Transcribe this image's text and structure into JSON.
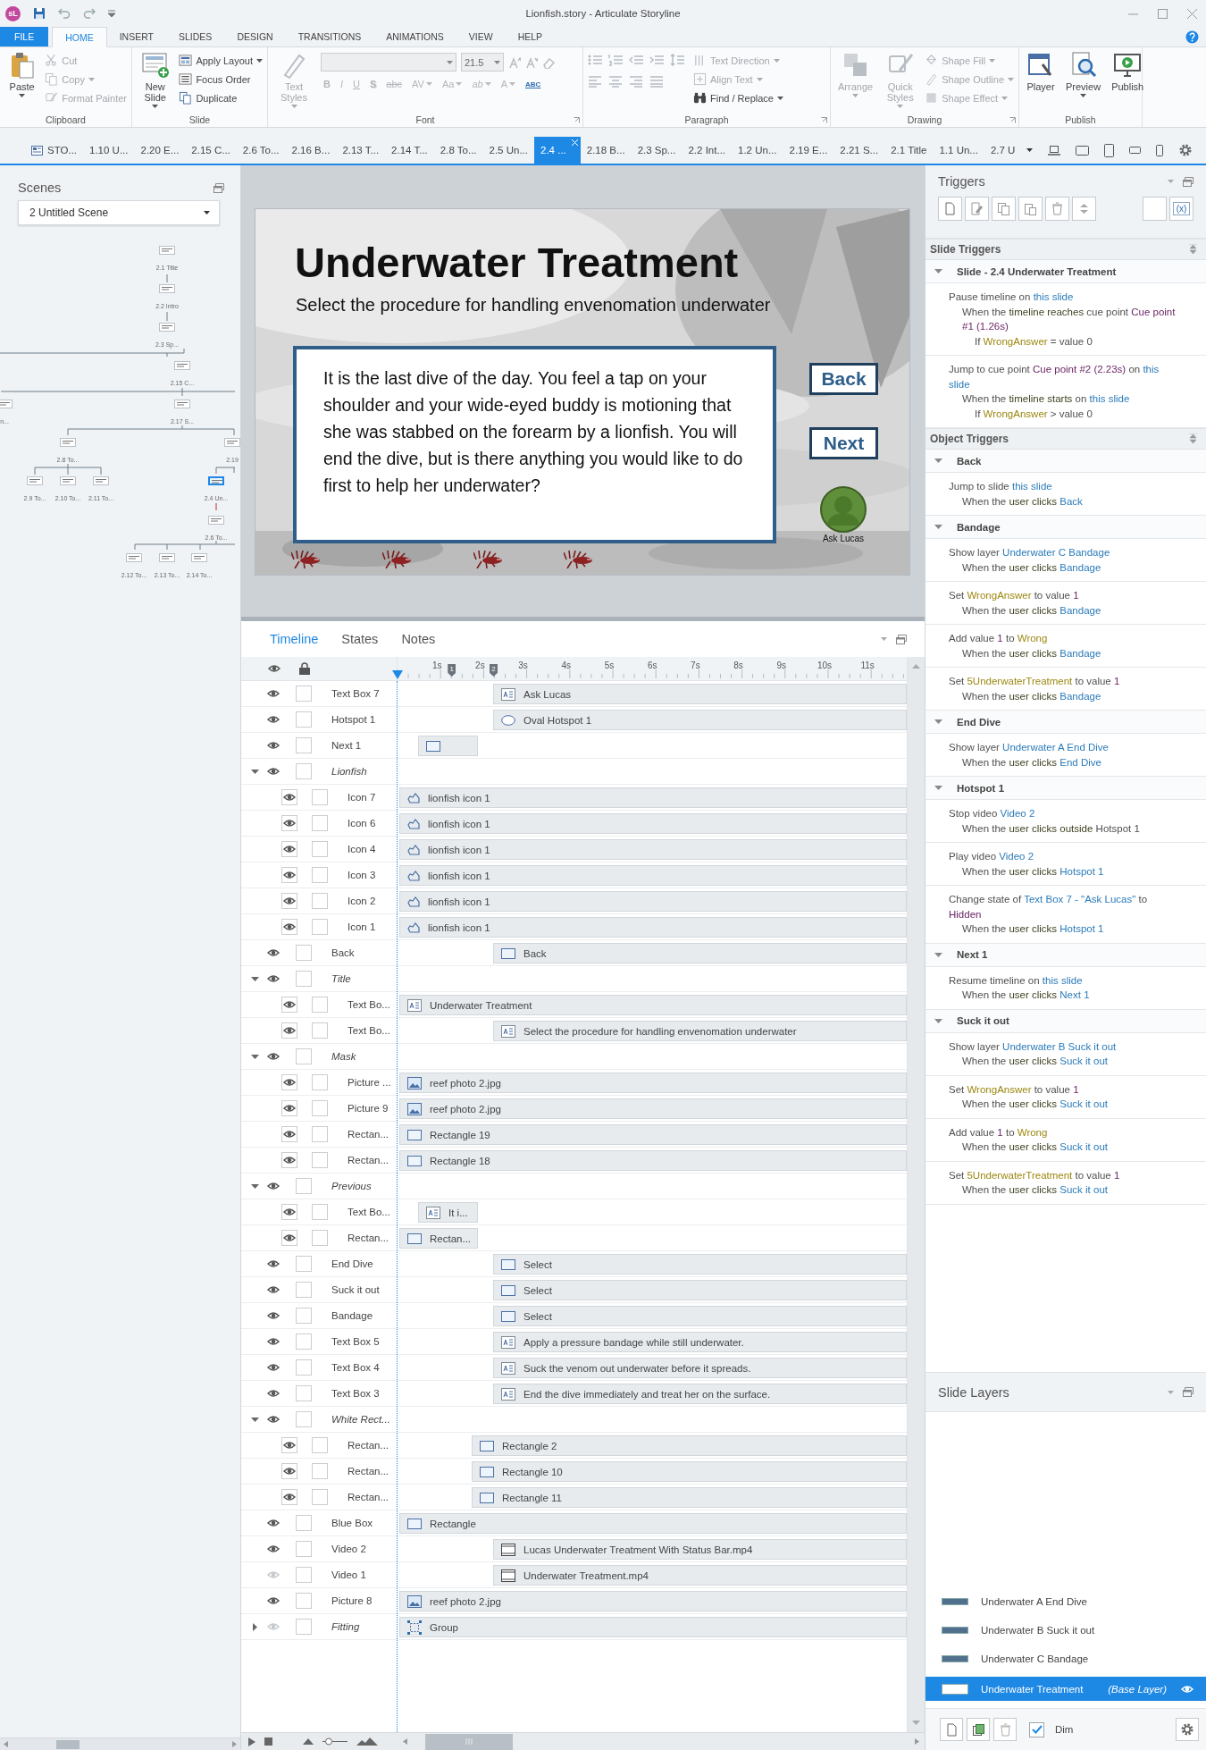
{
  "app": {
    "logo": "sL",
    "title": "Lionfish.story - Articulate Storyline"
  },
  "ribbon": {
    "tabs": [
      {
        "label": "FILE",
        "kind": "file",
        "selected": false
      },
      {
        "label": "HOME",
        "kind": "tab",
        "selected": true
      },
      {
        "label": "INSERT",
        "kind": "tab",
        "selected": false
      },
      {
        "label": "SLIDES",
        "kind": "tab",
        "selected": false
      },
      {
        "label": "DESIGN",
        "kind": "tab",
        "selected": false
      },
      {
        "label": "TRANSITIONS",
        "kind": "tab",
        "selected": false
      },
      {
        "label": "ANIMATIONS",
        "kind": "tab",
        "selected": false
      },
      {
        "label": "VIEW",
        "kind": "tab",
        "selected": false
      },
      {
        "label": "HELP",
        "kind": "tab",
        "selected": false
      }
    ],
    "groups": [
      {
        "label": "Clipboard",
        "kind": "clipboard",
        "large": [
          {
            "label": "Paste",
            "disabled": false,
            "dropdown": true
          }
        ],
        "small": [
          {
            "label": "Cut",
            "disabled": true,
            "dropdown": false
          },
          {
            "label": "Copy",
            "disabled": true,
            "dropdown": true
          },
          {
            "label": "Format Painter",
            "disabled": true,
            "dropdown": false
          }
        ]
      },
      {
        "label": "Slide",
        "kind": "slide",
        "large": [
          {
            "label": "New Slide",
            "disabled": false,
            "dropdown": true
          }
        ],
        "small": [
          {
            "label": "Apply Layout",
            "disabled": false,
            "dropdown": true
          },
          {
            "label": "Focus Order",
            "disabled": false,
            "dropdown": false
          },
          {
            "label": "Duplicate",
            "disabled": false,
            "dropdown": false
          }
        ]
      },
      {
        "label": "Font",
        "kind": "font",
        "large": [
          {
            "label": "Text Styles",
            "disabled": true,
            "dropdown": true
          }
        ],
        "font_size": "21.5",
        "glyphs": [
          {
            "text": "B",
            "disabled": true
          },
          {
            "text": "I",
            "disabled": true
          },
          {
            "text": "U",
            "disabled": true
          },
          {
            "text": "S",
            "disabled": true
          },
          {
            "text": "abc",
            "disabled": true
          },
          {
            "text": "AV",
            "disabled": true
          },
          {
            "text": "Aa",
            "disabled": true
          },
          {
            "text": "ab",
            "disabled": true
          },
          {
            "text": "A",
            "disabled": true
          },
          {
            "text": "ABC",
            "disabled": false
          }
        ]
      },
      {
        "label": "Paragraph",
        "kind": "paragraph",
        "small": [
          {
            "label": "Text Direction",
            "disabled": true,
            "dropdown": true
          },
          {
            "label": "Align Text",
            "disabled": true,
            "dropdown": true
          },
          {
            "label": "Find / Replace",
            "disabled": false,
            "dropdown": true
          }
        ]
      },
      {
        "label": "Drawing",
        "kind": "drawing",
        "large": [
          {
            "label": "Arrange",
            "disabled": true,
            "dropdown": true
          },
          {
            "label": "Quick Styles",
            "disabled": true,
            "dropdown": true
          }
        ],
        "small": [
          {
            "label": "Shape Fill",
            "disabled": true,
            "dropdown": true
          },
          {
            "label": "Shape Outline",
            "disabled": true,
            "dropdown": true
          },
          {
            "label": "Shape Effect",
            "disabled": true,
            "dropdown": true
          }
        ]
      },
      {
        "label": "Publish",
        "kind": "publish",
        "large": [
          {
            "label": "Player",
            "disabled": false,
            "dropdown": false
          },
          {
            "label": "Preview",
            "disabled": false,
            "dropdown": true
          },
          {
            "label": "Publish",
            "disabled": false,
            "dropdown": false
          }
        ]
      }
    ]
  },
  "slide_tabs": {
    "items": [
      {
        "label": "STO...",
        "kind": "story",
        "selected": false
      },
      {
        "label": "1.10 U...",
        "kind": "slide",
        "selected": false
      },
      {
        "label": "2.20 E...",
        "kind": "slide",
        "selected": false
      },
      {
        "label": "2.15 C...",
        "kind": "slide",
        "selected": false
      },
      {
        "label": "2.6 To...",
        "kind": "slide",
        "selected": false
      },
      {
        "label": "2.16 B...",
        "kind": "slide",
        "selected": false
      },
      {
        "label": "2.13 T...",
        "kind": "slide",
        "selected": false
      },
      {
        "label": "2.14 T...",
        "kind": "slide",
        "selected": false
      },
      {
        "label": "2.8 To...",
        "kind": "slide",
        "selected": false
      },
      {
        "label": "2.5 Un...",
        "kind": "slide",
        "selected": false
      },
      {
        "label": "2.4 ...",
        "kind": "slide",
        "selected": true
      },
      {
        "label": "2.18 B...",
        "kind": "slide",
        "selected": false
      },
      {
        "label": "2.3 Sp...",
        "kind": "slide",
        "selected": false
      },
      {
        "label": "2.2 Int...",
        "kind": "slide",
        "selected": false
      },
      {
        "label": "1.2 Un...",
        "kind": "slide",
        "selected": false
      },
      {
        "label": "2.19 E...",
        "kind": "slide",
        "selected": false
      },
      {
        "label": "2.21 S...",
        "kind": "slide",
        "selected": false
      },
      {
        "label": "2.1 Title",
        "kind": "slide",
        "selected": false
      },
      {
        "label": "1.1 Un...",
        "kind": "slide",
        "selected": false
      },
      {
        "label": "2.7 U",
        "kind": "slide",
        "selected": false
      }
    ]
  },
  "scenes": {
    "title": "Scenes",
    "scene_select": "2 Untitled Scene",
    "nodes": [
      {
        "label": "2.1 Title",
        "selected": false
      },
      {
        "label": "2.2 Intro",
        "selected": false
      },
      {
        "label": "2.3 Sp...",
        "selected": false
      },
      {
        "label": "2.15 C...",
        "selected": false
      },
      {
        "label": "n...",
        "selected": false
      },
      {
        "label": "2.17 S...",
        "selected": false
      },
      {
        "label": "2.8 To...",
        "selected": false
      },
      {
        "label": "2.19",
        "selected": false
      },
      {
        "label": "2.9 To...",
        "selected": false
      },
      {
        "label": "2.10 To...",
        "selected": false
      },
      {
        "label": "2.11 To...",
        "selected": false
      },
      {
        "label": "2.4 Un...",
        "selected": true
      },
      {
        "label": "2.6 To...",
        "selected": false
      },
      {
        "label": "2.12 To...",
        "selected": false
      },
      {
        "label": "2.13 To...",
        "selected": false
      },
      {
        "label": "2.14 To...",
        "selected": false
      }
    ]
  },
  "slide": {
    "title": "Underwater Treatment",
    "subtitle": "Select the procedure for handling envenomation underwater",
    "body": "It is the last dive of the day.  You feel a tap on your shoulder and your wide-eyed buddy is motioning that she was stabbed on the forearm by a lionfish.  You will end the dive, but is there anything you would like to do first to help her underwater?",
    "buttons": [
      "Back",
      "Next"
    ],
    "avatar_label": "Ask Lucas"
  },
  "timeline": {
    "tabs": [
      {
        "label": "Timeline",
        "selected": true
      },
      {
        "label": "States",
        "selected": false
      },
      {
        "label": "Notes",
        "selected": false
      }
    ],
    "ruler": [
      "1s",
      "2s",
      "3s",
      "4s",
      "5s",
      "6s",
      "7s",
      "8s",
      "9s",
      "10s",
      "11s"
    ],
    "cue_points": [
      "1",
      "2"
    ],
    "zoom": {
      "level": 0.15
    },
    "rows": [
      {
        "name": "Text Box 7",
        "kind": "object",
        "visible": true,
        "locked": false,
        "bar": {
          "label": "Ask Lucas",
          "kind": "text",
          "from_cue": true,
          "delayed": false,
          "late": false,
          "short": false
        }
      },
      {
        "name": "Hotspot 1",
        "kind": "object",
        "visible": true,
        "locked": false,
        "bar": {
          "label": "Oval Hotspot 1",
          "kind": "oval",
          "from_cue": true,
          "delayed": false,
          "late": false,
          "short": false
        }
      },
      {
        "name": "Next 1",
        "kind": "object",
        "visible": true,
        "locked": false,
        "bar": {
          "kind": "shape",
          "from_cue": false,
          "delayed": true,
          "late": false,
          "short": true
        }
      },
      {
        "name": "Lionfish",
        "kind": "group",
        "expanded": true,
        "visible": true,
        "locked": false,
        "children": [
          {
            "name": "Icon 7",
            "kind": "object",
            "visible": true,
            "locked": false,
            "bar": {
              "label": "lionfish icon 1",
              "kind": "icon",
              "from_cue": false,
              "delayed": false,
              "late": false,
              "short": false
            }
          },
          {
            "name": "Icon 6",
            "kind": "object",
            "visible": true,
            "locked": false,
            "bar": {
              "label": "lionfish icon 1",
              "kind": "icon",
              "from_cue": false,
              "delayed": false,
              "late": false,
              "short": false
            }
          },
          {
            "name": "Icon 4",
            "kind": "object",
            "visible": true,
            "locked": false,
            "bar": {
              "label": "lionfish icon 1",
              "kind": "icon",
              "from_cue": false,
              "delayed": false,
              "late": false,
              "short": false
            }
          },
          {
            "name": "Icon 3",
            "kind": "object",
            "visible": true,
            "locked": false,
            "bar": {
              "label": "lionfish icon 1",
              "kind": "icon",
              "from_cue": false,
              "delayed": false,
              "late": false,
              "short": false
            }
          },
          {
            "name": "Icon 2",
            "kind": "object",
            "visible": true,
            "locked": false,
            "bar": {
              "label": "lionfish icon 1",
              "kind": "icon",
              "from_cue": false,
              "delayed": false,
              "late": false,
              "short": false
            }
          },
          {
            "name": "Icon 1",
            "kind": "object",
            "visible": true,
            "locked": false,
            "bar": {
              "label": "lionfish icon 1",
              "kind": "icon",
              "from_cue": false,
              "delayed": false,
              "late": false,
              "short": false
            }
          }
        ]
      },
      {
        "name": "Back",
        "kind": "object",
        "visible": true,
        "locked": false,
        "bar": {
          "label": "Back",
          "kind": "shape",
          "from_cue": true,
          "delayed": false,
          "late": false,
          "short": false
        }
      },
      {
        "name": "Title",
        "kind": "group",
        "expanded": true,
        "visible": true,
        "locked": false,
        "children": [
          {
            "name": "Text Bo...",
            "kind": "object",
            "visible": true,
            "locked": false,
            "bar": {
              "label": "Underwater Treatment",
              "kind": "text",
              "from_cue": false,
              "delayed": false,
              "late": false,
              "short": false
            }
          },
          {
            "name": "Text Bo...",
            "kind": "object",
            "visible": true,
            "locked": false,
            "bar": {
              "label": "Select the procedure for handling envenomation underwater",
              "kind": "text",
              "from_cue": true,
              "delayed": false,
              "late": false,
              "short": false
            }
          }
        ]
      },
      {
        "name": "Mask",
        "kind": "group",
        "expanded": true,
        "visible": true,
        "locked": false,
        "children": [
          {
            "name": "Picture ...",
            "kind": "object",
            "visible": true,
            "locked": false,
            "bar": {
              "label": "reef photo 2.jpg",
              "kind": "picture",
              "from_cue": false,
              "delayed": false,
              "late": false,
              "short": false
            }
          },
          {
            "name": "Picture 9",
            "kind": "object",
            "visible": true,
            "locked": false,
            "bar": {
              "label": "reef photo 2.jpg",
              "kind": "picture",
              "from_cue": false,
              "delayed": false,
              "late": false,
              "short": false
            }
          },
          {
            "name": "Rectan...",
            "kind": "object",
            "visible": true,
            "locked": false,
            "bar": {
              "label": "Rectangle 19",
              "kind": "shape",
              "from_cue": false,
              "delayed": false,
              "late": false,
              "short": false
            }
          },
          {
            "name": "Rectan...",
            "kind": "object",
            "visible": true,
            "locked": false,
            "bar": {
              "label": "Rectangle 18",
              "kind": "shape",
              "from_cue": false,
              "delayed": false,
              "late": false,
              "short": false
            }
          }
        ]
      },
      {
        "name": "Previous",
        "kind": "group",
        "expanded": true,
        "visible": true,
        "locked": false,
        "children": [
          {
            "name": "Text Bo...",
            "kind": "object",
            "visible": true,
            "locked": false,
            "bar": {
              "label": "It i...",
              "kind": "text",
              "from_cue": false,
              "delayed": true,
              "late": false,
              "short": true
            }
          },
          {
            "name": "Rectan...",
            "kind": "object",
            "visible": true,
            "locked": false,
            "bar": {
              "label": "Rectan...",
              "kind": "shape",
              "from_cue": false,
              "delayed": false,
              "late": false,
              "short": true
            }
          }
        ]
      },
      {
        "name": "End Dive",
        "kind": "object",
        "visible": true,
        "locked": false,
        "bar": {
          "label": "Select",
          "kind": "shape",
          "from_cue": true,
          "delayed": false,
          "late": false,
          "short": false
        }
      },
      {
        "name": "Suck it out",
        "kind": "object",
        "visible": true,
        "locked": false,
        "bar": {
          "label": "Select",
          "kind": "shape",
          "from_cue": true,
          "delayed": false,
          "late": false,
          "short": false
        }
      },
      {
        "name": "Bandage",
        "kind": "object",
        "visible": true,
        "locked": false,
        "bar": {
          "label": "Select",
          "kind": "shape",
          "from_cue": true,
          "delayed": false,
          "late": false,
          "short": false
        }
      },
      {
        "name": "Text Box 5",
        "kind": "object",
        "visible": true,
        "locked": false,
        "bar": {
          "label": "Apply a pressure bandage while still underwater.",
          "kind": "text",
          "from_cue": true,
          "delayed": false,
          "late": false,
          "short": false
        }
      },
      {
        "name": "Text Box 4",
        "kind": "object",
        "visible": true,
        "locked": false,
        "bar": {
          "label": "Suck the venom out underwater before it spreads.",
          "kind": "text",
          "from_cue": true,
          "delayed": false,
          "late": false,
          "short": false
        }
      },
      {
        "name": "Text Box 3",
        "kind": "object",
        "visible": true,
        "locked": false,
        "bar": {
          "label": "End the dive immediately and treat her on the surface.",
          "kind": "text",
          "from_cue": true,
          "delayed": false,
          "late": false,
          "short": false
        }
      },
      {
        "name": "White Rect...",
        "kind": "group",
        "expanded": true,
        "visible": true,
        "locked": false,
        "children": [
          {
            "name": "Rectan...",
            "kind": "object",
            "visible": true,
            "locked": false,
            "bar": {
              "label": "Rectangle 2",
              "kind": "shape",
              "from_cue": false,
              "delayed": false,
              "late": true,
              "short": false
            }
          },
          {
            "name": "Rectan...",
            "kind": "object",
            "visible": true,
            "locked": false,
            "bar": {
              "label": "Rectangle 10",
              "kind": "shape",
              "from_cue": false,
              "delayed": false,
              "late": true,
              "short": false
            }
          },
          {
            "name": "Rectan...",
            "kind": "object",
            "visible": true,
            "locked": false,
            "bar": {
              "label": "Rectangle 11",
              "kind": "shape",
              "from_cue": false,
              "delayed": false,
              "late": true,
              "short": false
            }
          }
        ]
      },
      {
        "name": "Blue Box",
        "kind": "object",
        "visible": true,
        "locked": false,
        "bar": {
          "label": "Rectangle",
          "kind": "shape",
          "from_cue": false,
          "delayed": false,
          "late": false,
          "short": false
        }
      },
      {
        "name": "Video 2",
        "kind": "object",
        "visible": true,
        "locked": false,
        "bar": {
          "label": "Lucas Underwater Treatment With Status Bar.mp4",
          "kind": "video",
          "from_cue": true,
          "delayed": false,
          "late": false,
          "short": false
        }
      },
      {
        "name": "Video 1",
        "kind": "object",
        "visible": false,
        "locked": false,
        "bar": {
          "label": "Underwater Treatment.mp4",
          "kind": "video",
          "from_cue": true,
          "delayed": false,
          "late": false,
          "short": false
        }
      },
      {
        "name": "Picture 8",
        "kind": "object",
        "visible": true,
        "locked": false,
        "bar": {
          "label": "reef photo 2.jpg",
          "kind": "picture",
          "from_cue": false,
          "delayed": false,
          "late": false,
          "short": false
        }
      },
      {
        "name": "Fitting",
        "kind": "group",
        "expanded": false,
        "visible": false,
        "locked": false,
        "bar": {
          "label": "Group",
          "kind": "group",
          "from_cue": false,
          "delayed": false,
          "late": false,
          "short": false
        }
      }
    ]
  },
  "triggers": {
    "title": "Triggers",
    "variables_button": "(x)",
    "sections": [
      {
        "title": "Slide Triggers",
        "groups": [
          {
            "title": "Slide - 2.4 Underwater Treatment",
            "expanded": true,
            "triggers": [
              {
                "action": [
                  {
                    "t": "Pause timeline on "
                  },
                  {
                    "t": "this slide",
                    "kind": "object"
                  }
                ],
                "event": [
                  {
                    "t": "When the "
                  },
                  {
                    "t": "timeline reaches",
                    "kind": "event"
                  },
                  {
                    "t": " cue point "
                  },
                  {
                    "t": "Cue point #1 (1.26s)",
                    "kind": "value"
                  }
                ],
                "condition": [
                  {
                    "t": "If "
                  },
                  {
                    "t": "WrongAnswer",
                    "kind": "variable"
                  },
                  {
                    "t": " = value 0"
                  }
                ]
              },
              {
                "action": [
                  {
                    "t": "Jump to cue point "
                  },
                  {
                    "t": "Cue point #2 (2.23s)",
                    "kind": "value"
                  },
                  {
                    "t": " on "
                  },
                  {
                    "t": "this slide",
                    "kind": "object"
                  }
                ],
                "event": [
                  {
                    "t": "When the "
                  },
                  {
                    "t": "timeline starts",
                    "kind": "event"
                  },
                  {
                    "t": " on "
                  },
                  {
                    "t": "this slide",
                    "kind": "object"
                  }
                ],
                "condition": [
                  {
                    "t": "If "
                  },
                  {
                    "t": "WrongAnswer",
                    "kind": "variable"
                  },
                  {
                    "t": " > value 0"
                  }
                ]
              }
            ]
          }
        ]
      },
      {
        "title": "Object Triggers",
        "groups": [
          {
            "title": "Back",
            "expanded": true,
            "triggers": [
              {
                "action": [
                  {
                    "t": "Jump to slide "
                  },
                  {
                    "t": "this slide",
                    "kind": "object"
                  }
                ],
                "event": [
                  {
                    "t": "When the "
                  },
                  {
                    "t": "user clicks ",
                    "kind": "event"
                  },
                  {
                    "t": "Back",
                    "kind": "object"
                  }
                ]
              }
            ]
          },
          {
            "title": "Bandage",
            "expanded": true,
            "triggers": [
              {
                "action": [
                  {
                    "t": "Show layer "
                  },
                  {
                    "t": "Underwater C Bandage",
                    "kind": "object"
                  }
                ],
                "event": [
                  {
                    "t": "When the "
                  },
                  {
                    "t": "user clicks ",
                    "kind": "event"
                  },
                  {
                    "t": "Bandage",
                    "kind": "object"
                  }
                ]
              },
              {
                "action": [
                  {
                    "t": "Set "
                  },
                  {
                    "t": "WrongAnswer",
                    "kind": "variable"
                  },
                  {
                    "t": " to value "
                  },
                  {
                    "t": "1",
                    "kind": "value"
                  }
                ],
                "event": [
                  {
                    "t": "When the "
                  },
                  {
                    "t": "user clicks ",
                    "kind": "event"
                  },
                  {
                    "t": "Bandage",
                    "kind": "object"
                  }
                ]
              },
              {
                "action": [
                  {
                    "t": "Add value "
                  },
                  {
                    "t": "1",
                    "kind": "value"
                  },
                  {
                    "t": " to "
                  },
                  {
                    "t": "Wrong",
                    "kind": "variable"
                  }
                ],
                "event": [
                  {
                    "t": "When the "
                  },
                  {
                    "t": "user clicks ",
                    "kind": "event"
                  },
                  {
                    "t": "Bandage",
                    "kind": "object"
                  }
                ]
              },
              {
                "action": [
                  {
                    "t": "Set "
                  },
                  {
                    "t": "5UnderwaterTreatment",
                    "kind": "variable"
                  },
                  {
                    "t": " to value "
                  },
                  {
                    "t": "1",
                    "kind": "value"
                  }
                ],
                "event": [
                  {
                    "t": "When the "
                  },
                  {
                    "t": "user clicks ",
                    "kind": "event"
                  },
                  {
                    "t": "Bandage",
                    "kind": "object"
                  }
                ]
              }
            ]
          },
          {
            "title": "End Dive",
            "expanded": true,
            "triggers": [
              {
                "action": [
                  {
                    "t": "Show layer "
                  },
                  {
                    "t": "Underwater A End Dive",
                    "kind": "object"
                  }
                ],
                "event": [
                  {
                    "t": "When the "
                  },
                  {
                    "t": "user clicks ",
                    "kind": "event"
                  },
                  {
                    "t": "End Dive",
                    "kind": "object"
                  }
                ]
              }
            ]
          },
          {
            "title": "Hotspot 1",
            "expanded": true,
            "triggers": [
              {
                "action": [
                  {
                    "t": "Stop video "
                  },
                  {
                    "t": "Video 2",
                    "kind": "object"
                  }
                ],
                "event": [
                  {
                    "t": "When the "
                  },
                  {
                    "t": "user clicks outside",
                    "kind": "event"
                  },
                  {
                    "t": " Hotspot 1"
                  }
                ]
              },
              {
                "action": [
                  {
                    "t": "Play video "
                  },
                  {
                    "t": "Video 2",
                    "kind": "object"
                  }
                ],
                "event": [
                  {
                    "t": "When the "
                  },
                  {
                    "t": "user clicks ",
                    "kind": "event"
                  },
                  {
                    "t": "Hotspot 1",
                    "kind": "object"
                  }
                ]
              },
              {
                "action": [
                  {
                    "t": "Change state of "
                  },
                  {
                    "t": "Text Box 7 - \"Ask Lucas\"",
                    "kind": "object"
                  },
                  {
                    "t": " to "
                  },
                  {
                    "t": "Hidden",
                    "kind": "value"
                  }
                ],
                "event": [
                  {
                    "t": "When the "
                  },
                  {
                    "t": "user clicks ",
                    "kind": "event"
                  },
                  {
                    "t": "Hotspot 1",
                    "kind": "object"
                  }
                ]
              }
            ]
          },
          {
            "title": "Next 1",
            "expanded": true,
            "triggers": [
              {
                "action": [
                  {
                    "t": "Resume timeline on "
                  },
                  {
                    "t": "this slide",
                    "kind": "object"
                  }
                ],
                "event": [
                  {
                    "t": "When the "
                  },
                  {
                    "t": "user clicks ",
                    "kind": "event"
                  },
                  {
                    "t": "Next 1",
                    "kind": "object"
                  }
                ]
              }
            ]
          },
          {
            "title": "Suck it out",
            "expanded": true,
            "triggers": [
              {
                "action": [
                  {
                    "t": "Show layer "
                  },
                  {
                    "t": "Underwater B Suck it out",
                    "kind": "object"
                  }
                ],
                "event": [
                  {
                    "t": "When the "
                  },
                  {
                    "t": "user clicks ",
                    "kind": "event"
                  },
                  {
                    "t": "Suck it out",
                    "kind": "object"
                  }
                ]
              },
              {
                "action": [
                  {
                    "t": "Set "
                  },
                  {
                    "t": "WrongAnswer",
                    "kind": "variable"
                  },
                  {
                    "t": " to value "
                  },
                  {
                    "t": "1",
                    "kind": "value"
                  }
                ],
                "event": [
                  {
                    "t": "When the "
                  },
                  {
                    "t": "user clicks ",
                    "kind": "event"
                  },
                  {
                    "t": "Suck it out",
                    "kind": "object"
                  }
                ]
              },
              {
                "action": [
                  {
                    "t": "Add value "
                  },
                  {
                    "t": "1",
                    "kind": "value"
                  },
                  {
                    "t": " to "
                  },
                  {
                    "t": "Wrong",
                    "kind": "variable"
                  }
                ],
                "event": [
                  {
                    "t": "When the "
                  },
                  {
                    "t": "user clicks ",
                    "kind": "event"
                  },
                  {
                    "t": "Suck it out",
                    "kind": "object"
                  }
                ]
              },
              {
                "action": [
                  {
                    "t": "Set "
                  },
                  {
                    "t": "5UnderwaterTreatment",
                    "kind": "variable"
                  },
                  {
                    "t": " to value "
                  },
                  {
                    "t": "1",
                    "kind": "value"
                  }
                ],
                "event": [
                  {
                    "t": "When the "
                  },
                  {
                    "t": "user clicks ",
                    "kind": "event"
                  },
                  {
                    "t": "Suck it out",
                    "kind": "object"
                  }
                ]
              }
            ]
          }
        ]
      }
    ]
  },
  "layers": {
    "title": "Slide Layers",
    "items": [
      {
        "name": "Underwater A End Dive",
        "kind": "layer",
        "selected": false
      },
      {
        "name": "Underwater B Suck it out",
        "kind": "layer",
        "selected": false
      },
      {
        "name": "Underwater C Bandage",
        "kind": "layer",
        "selected": false
      },
      {
        "name": "Underwater Treatment",
        "kind": "base",
        "note": "(Base Layer)",
        "selected": true
      }
    ],
    "dim": {
      "label": "Dim",
      "checked": true
    }
  }
}
